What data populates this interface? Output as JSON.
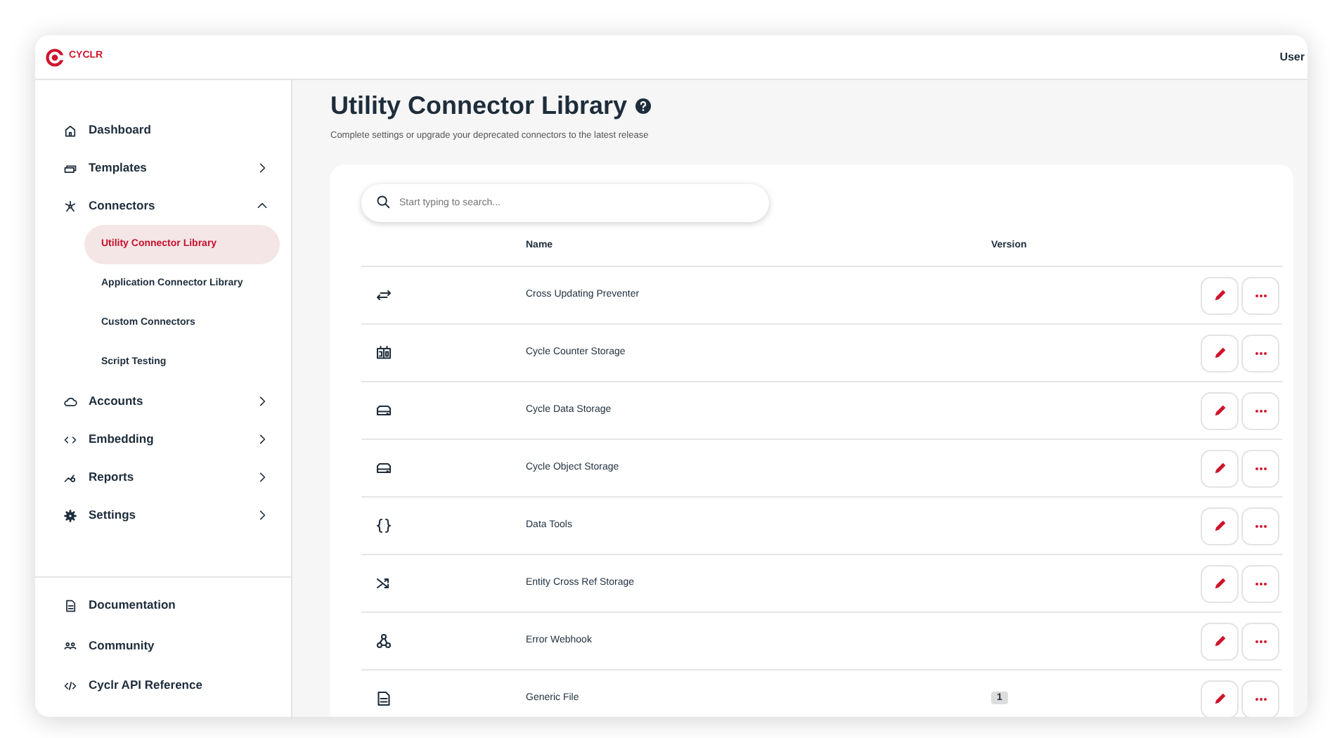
{
  "header": {
    "logo_text": "CYCLR",
    "user": "User"
  },
  "sidebar": {
    "items": [
      {
        "label": "Dashboard"
      },
      {
        "label": "Templates",
        "expanded": false
      },
      {
        "label": "Connectors",
        "expanded": true,
        "children": [
          {
            "label": "Utility Connector Library",
            "selected": true
          },
          {
            "label": "Application Connector Library",
            "selected": false
          },
          {
            "label": "Custom Connectors",
            "selected": false
          },
          {
            "label": "Script Testing",
            "selected": false
          }
        ]
      },
      {
        "label": "Accounts",
        "expanded": false
      },
      {
        "label": "Embedding",
        "expanded": false
      },
      {
        "label": "Reports",
        "expanded": false
      },
      {
        "label": "Settings",
        "expanded": false
      }
    ],
    "footer_items": [
      {
        "label": "Documentation"
      },
      {
        "label": "Community"
      },
      {
        "label": "Cyclr API Reference"
      }
    ]
  },
  "page": {
    "title": "Utility Connector Library",
    "subtitle": "Complete settings or upgrade your deprecated connectors to the latest release"
  },
  "search": {
    "placeholder": "Start typing to search..."
  },
  "table": {
    "columns": [
      "Name",
      "Version"
    ],
    "rows": [
      {
        "name": "Cross Updating Preventer"
      },
      {
        "name": "Cycle Counter Storage"
      },
      {
        "name": "Cycle Data Storage"
      },
      {
        "name": "Cycle Object Storage"
      },
      {
        "name": "Data Tools"
      },
      {
        "name": "Entity Cross Ref Storage"
      },
      {
        "name": "Error Webhook"
      },
      {
        "name": "Generic File",
        "version": "1"
      }
    ]
  }
}
